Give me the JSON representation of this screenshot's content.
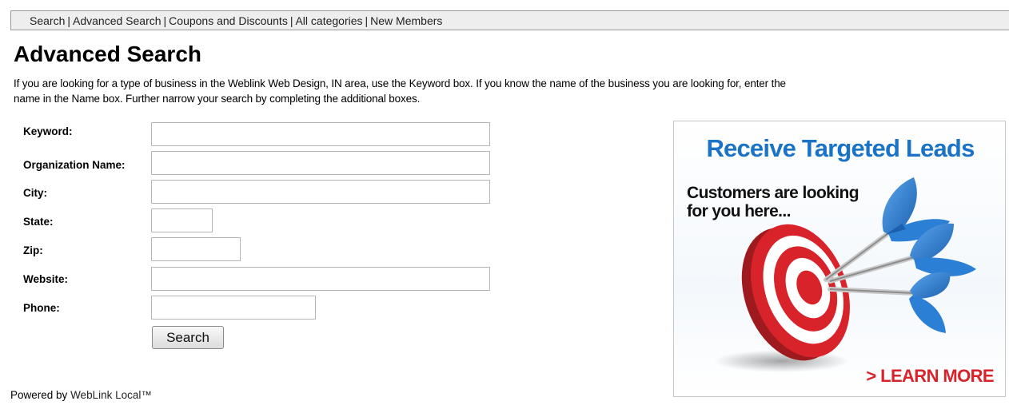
{
  "nav": {
    "items": [
      {
        "label": "Search"
      },
      {
        "label": "Advanced Search"
      },
      {
        "label": "Coupons and Discounts"
      },
      {
        "label": "All categories"
      },
      {
        "label": "New Members"
      }
    ],
    "separator": "|"
  },
  "page": {
    "title": "Advanced Search",
    "intro_line1": "If you are looking for a type of business in the Weblink Web Design, IN area, use the Keyword box. If you know the name of the business you are looking for, enter the",
    "intro_line2": "name in the Name box. Further narrow your search by completing the additional boxes."
  },
  "form": {
    "fields": [
      {
        "label": "Keyword:",
        "value": ""
      },
      {
        "label": "Organization Name:",
        "value": ""
      },
      {
        "label": "City:",
        "value": ""
      },
      {
        "label": "State:",
        "value": ""
      },
      {
        "label": "Zip:",
        "value": ""
      },
      {
        "label": "Website:",
        "value": ""
      },
      {
        "label": "Phone:",
        "value": ""
      }
    ],
    "submit_label": "Search"
  },
  "footer": {
    "powered_prefix": "Powered by",
    "powered_link": "WebLink Local™"
  },
  "ad": {
    "headline": "Receive Targeted Leads",
    "subtext_line1": "Customers are looking",
    "subtext_line2": "for you here...",
    "cta_arrow": ">",
    "cta_label": "LEARN MORE",
    "colors": {
      "headline": "#1a73c7",
      "cta": "#d8232a",
      "target_red": "#d8232a",
      "dart_blue": "#2b7fd4"
    }
  }
}
